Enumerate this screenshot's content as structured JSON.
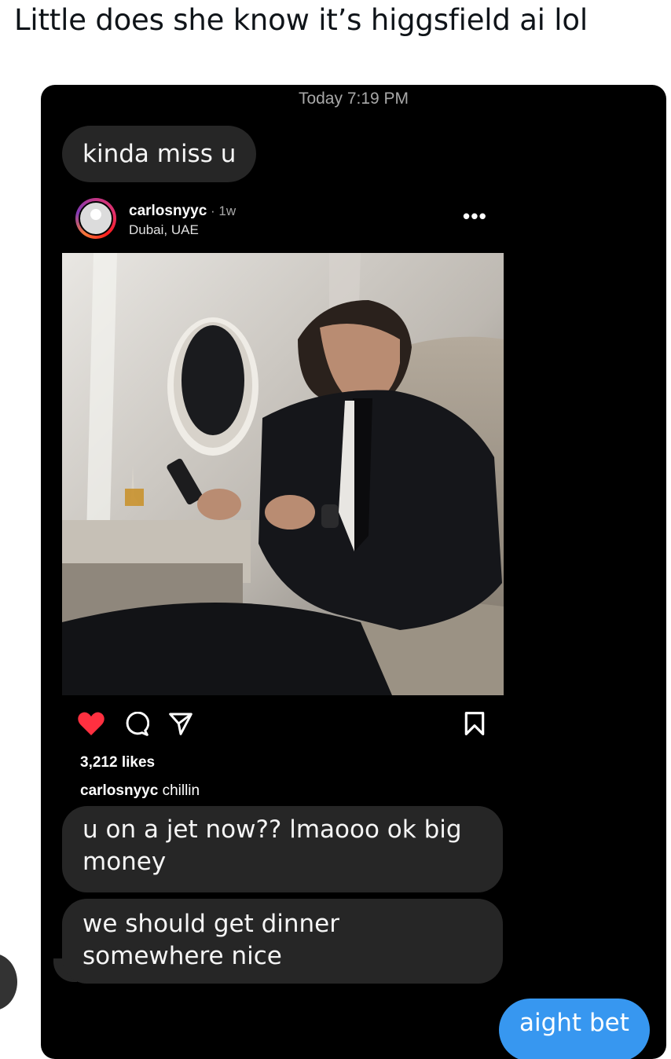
{
  "tweet": {
    "text": "Little does she know it’s higgsfield ai lol"
  },
  "dm": {
    "timestamp": "Today 7:19 PM",
    "messages": [
      {
        "text": "kinda miss u",
        "sender": "other"
      },
      {
        "text": "u on a jet now?? lmaooo ok big money",
        "sender": "other"
      },
      {
        "text": "we should get dinner somewhere nice",
        "sender": "other"
      },
      {
        "text": "aight bet",
        "sender": "me"
      }
    ]
  },
  "shared_post": {
    "username": "carlosnyyc",
    "separator": " · ",
    "time_ago": "1w",
    "location": "Dubai, UAE",
    "likes": "3,212 likes",
    "caption_user": "carlosnyyc",
    "caption_text": " chillin",
    "liked": true,
    "icons": [
      "heart-icon",
      "comment-icon",
      "share-icon",
      "bookmark-icon",
      "more-icon"
    ]
  },
  "colors": {
    "background": "#000000",
    "bubble_received": "#262626",
    "bubble_sent": "#3797f0",
    "heart": "#ff3040"
  }
}
